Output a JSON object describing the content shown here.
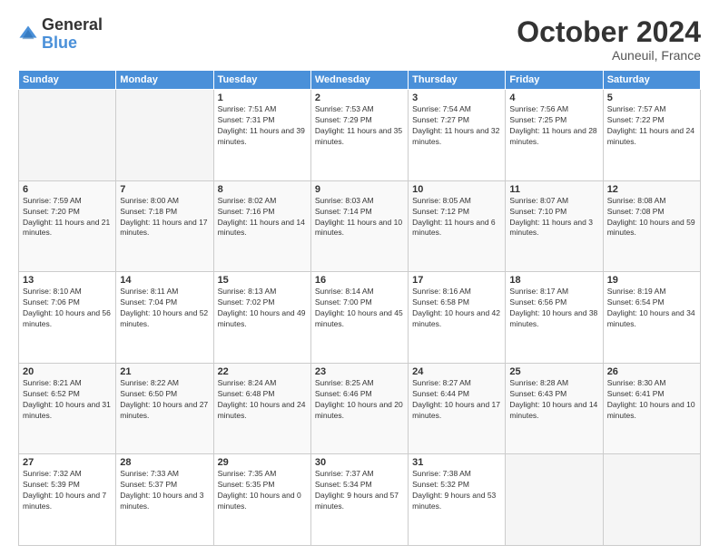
{
  "header": {
    "logo_line1": "General",
    "logo_line2": "Blue",
    "month_title": "October 2024",
    "location": "Auneuil, France"
  },
  "days_of_week": [
    "Sunday",
    "Monday",
    "Tuesday",
    "Wednesday",
    "Thursday",
    "Friday",
    "Saturday"
  ],
  "weeks": [
    [
      {
        "day": "",
        "empty": true
      },
      {
        "day": "",
        "empty": true
      },
      {
        "day": "1",
        "sunrise": "Sunrise: 7:51 AM",
        "sunset": "Sunset: 7:31 PM",
        "daylight": "Daylight: 11 hours and 39 minutes."
      },
      {
        "day": "2",
        "sunrise": "Sunrise: 7:53 AM",
        "sunset": "Sunset: 7:29 PM",
        "daylight": "Daylight: 11 hours and 35 minutes."
      },
      {
        "day": "3",
        "sunrise": "Sunrise: 7:54 AM",
        "sunset": "Sunset: 7:27 PM",
        "daylight": "Daylight: 11 hours and 32 minutes."
      },
      {
        "day": "4",
        "sunrise": "Sunrise: 7:56 AM",
        "sunset": "Sunset: 7:25 PM",
        "daylight": "Daylight: 11 hours and 28 minutes."
      },
      {
        "day": "5",
        "sunrise": "Sunrise: 7:57 AM",
        "sunset": "Sunset: 7:22 PM",
        "daylight": "Daylight: 11 hours and 24 minutes."
      }
    ],
    [
      {
        "day": "6",
        "sunrise": "Sunrise: 7:59 AM",
        "sunset": "Sunset: 7:20 PM",
        "daylight": "Daylight: 11 hours and 21 minutes."
      },
      {
        "day": "7",
        "sunrise": "Sunrise: 8:00 AM",
        "sunset": "Sunset: 7:18 PM",
        "daylight": "Daylight: 11 hours and 17 minutes."
      },
      {
        "day": "8",
        "sunrise": "Sunrise: 8:02 AM",
        "sunset": "Sunset: 7:16 PM",
        "daylight": "Daylight: 11 hours and 14 minutes."
      },
      {
        "day": "9",
        "sunrise": "Sunrise: 8:03 AM",
        "sunset": "Sunset: 7:14 PM",
        "daylight": "Daylight: 11 hours and 10 minutes."
      },
      {
        "day": "10",
        "sunrise": "Sunrise: 8:05 AM",
        "sunset": "Sunset: 7:12 PM",
        "daylight": "Daylight: 11 hours and 6 minutes."
      },
      {
        "day": "11",
        "sunrise": "Sunrise: 8:07 AM",
        "sunset": "Sunset: 7:10 PM",
        "daylight": "Daylight: 11 hours and 3 minutes."
      },
      {
        "day": "12",
        "sunrise": "Sunrise: 8:08 AM",
        "sunset": "Sunset: 7:08 PM",
        "daylight": "Daylight: 10 hours and 59 minutes."
      }
    ],
    [
      {
        "day": "13",
        "sunrise": "Sunrise: 8:10 AM",
        "sunset": "Sunset: 7:06 PM",
        "daylight": "Daylight: 10 hours and 56 minutes."
      },
      {
        "day": "14",
        "sunrise": "Sunrise: 8:11 AM",
        "sunset": "Sunset: 7:04 PM",
        "daylight": "Daylight: 10 hours and 52 minutes."
      },
      {
        "day": "15",
        "sunrise": "Sunrise: 8:13 AM",
        "sunset": "Sunset: 7:02 PM",
        "daylight": "Daylight: 10 hours and 49 minutes."
      },
      {
        "day": "16",
        "sunrise": "Sunrise: 8:14 AM",
        "sunset": "Sunset: 7:00 PM",
        "daylight": "Daylight: 10 hours and 45 minutes."
      },
      {
        "day": "17",
        "sunrise": "Sunrise: 8:16 AM",
        "sunset": "Sunset: 6:58 PM",
        "daylight": "Daylight: 10 hours and 42 minutes."
      },
      {
        "day": "18",
        "sunrise": "Sunrise: 8:17 AM",
        "sunset": "Sunset: 6:56 PM",
        "daylight": "Daylight: 10 hours and 38 minutes."
      },
      {
        "day": "19",
        "sunrise": "Sunrise: 8:19 AM",
        "sunset": "Sunset: 6:54 PM",
        "daylight": "Daylight: 10 hours and 34 minutes."
      }
    ],
    [
      {
        "day": "20",
        "sunrise": "Sunrise: 8:21 AM",
        "sunset": "Sunset: 6:52 PM",
        "daylight": "Daylight: 10 hours and 31 minutes."
      },
      {
        "day": "21",
        "sunrise": "Sunrise: 8:22 AM",
        "sunset": "Sunset: 6:50 PM",
        "daylight": "Daylight: 10 hours and 27 minutes."
      },
      {
        "day": "22",
        "sunrise": "Sunrise: 8:24 AM",
        "sunset": "Sunset: 6:48 PM",
        "daylight": "Daylight: 10 hours and 24 minutes."
      },
      {
        "day": "23",
        "sunrise": "Sunrise: 8:25 AM",
        "sunset": "Sunset: 6:46 PM",
        "daylight": "Daylight: 10 hours and 20 minutes."
      },
      {
        "day": "24",
        "sunrise": "Sunrise: 8:27 AM",
        "sunset": "Sunset: 6:44 PM",
        "daylight": "Daylight: 10 hours and 17 minutes."
      },
      {
        "day": "25",
        "sunrise": "Sunrise: 8:28 AM",
        "sunset": "Sunset: 6:43 PM",
        "daylight": "Daylight: 10 hours and 14 minutes."
      },
      {
        "day": "26",
        "sunrise": "Sunrise: 8:30 AM",
        "sunset": "Sunset: 6:41 PM",
        "daylight": "Daylight: 10 hours and 10 minutes."
      }
    ],
    [
      {
        "day": "27",
        "sunrise": "Sunrise: 7:32 AM",
        "sunset": "Sunset: 5:39 PM",
        "daylight": "Daylight: 10 hours and 7 minutes."
      },
      {
        "day": "28",
        "sunrise": "Sunrise: 7:33 AM",
        "sunset": "Sunset: 5:37 PM",
        "daylight": "Daylight: 10 hours and 3 minutes."
      },
      {
        "day": "29",
        "sunrise": "Sunrise: 7:35 AM",
        "sunset": "Sunset: 5:35 PM",
        "daylight": "Daylight: 10 hours and 0 minutes."
      },
      {
        "day": "30",
        "sunrise": "Sunrise: 7:37 AM",
        "sunset": "Sunset: 5:34 PM",
        "daylight": "Daylight: 9 hours and 57 minutes."
      },
      {
        "day": "31",
        "sunrise": "Sunrise: 7:38 AM",
        "sunset": "Sunset: 5:32 PM",
        "daylight": "Daylight: 9 hours and 53 minutes."
      },
      {
        "day": "",
        "empty": true
      },
      {
        "day": "",
        "empty": true
      }
    ]
  ]
}
